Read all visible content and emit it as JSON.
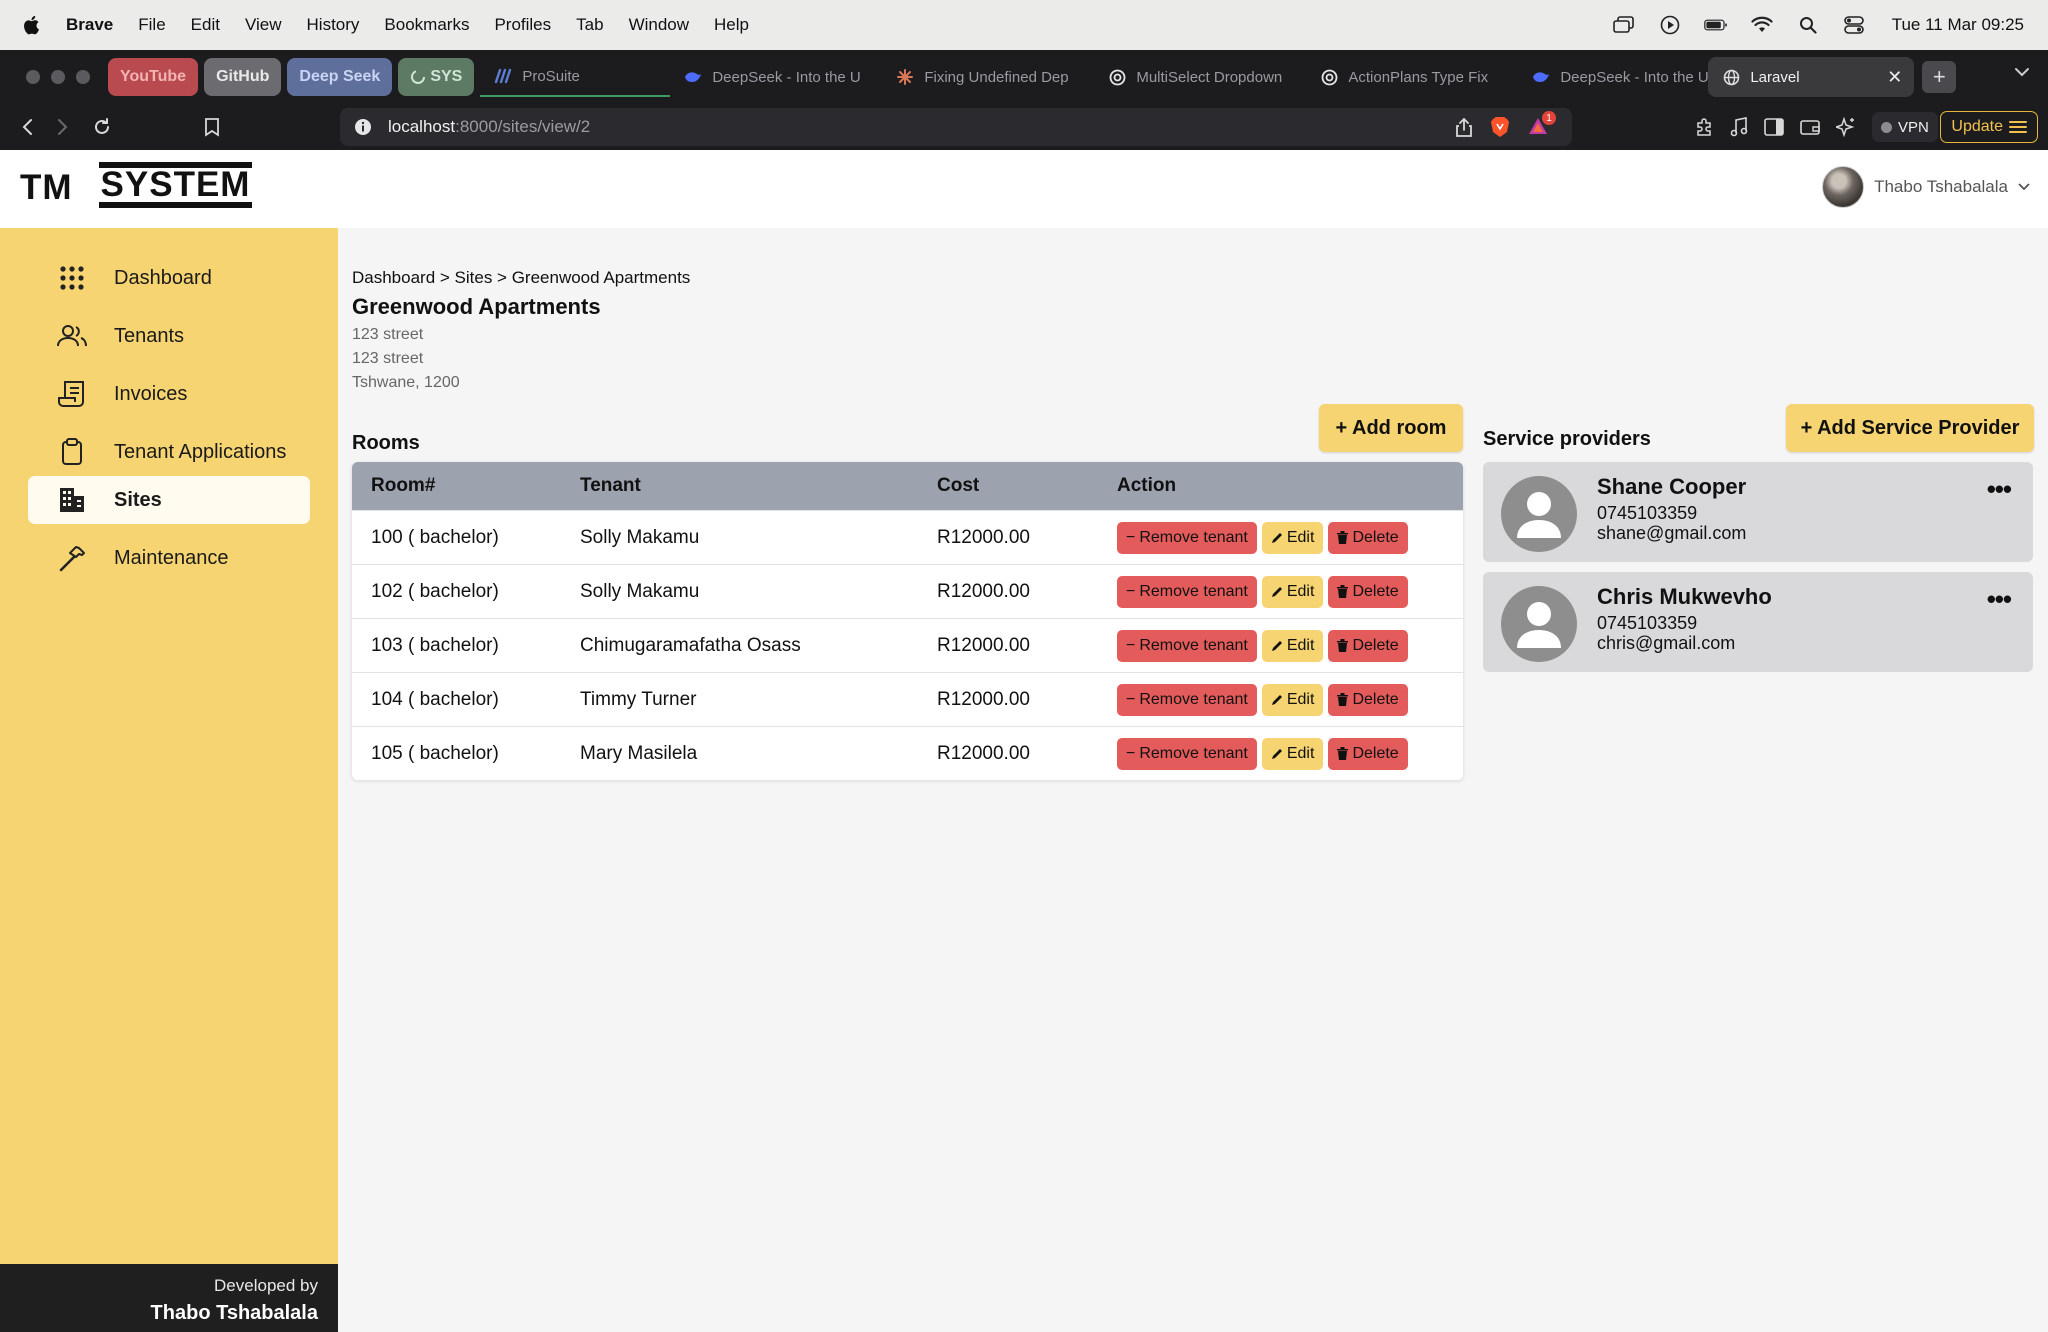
{
  "menubar": {
    "app_name": "Brave",
    "items": [
      "File",
      "Edit",
      "View",
      "History",
      "Bookmarks",
      "Profiles",
      "Tab",
      "Window",
      "Help"
    ],
    "clock": "Tue 11 Mar  09:25"
  },
  "browser": {
    "pinned_tabs": [
      {
        "label": "YouTube",
        "bg": "#b94a4f",
        "fg": "#f2b3b3"
      },
      {
        "label": "GitHub",
        "bg": "#6b6b70",
        "fg": "#e9e9ea"
      },
      {
        "label": "Deep Seek",
        "bg": "#5e6f9c",
        "fg": "#c9d4f4"
      },
      {
        "label": "SYS",
        "bg": "#5d7a65",
        "fg": "#cfe5d5"
      }
    ],
    "tabs": [
      {
        "label": "ProSuite",
        "icon": "prosuite-icon"
      },
      {
        "label": "DeepSeek - Into the U",
        "icon": "deepseek-icon"
      },
      {
        "label": "Fixing Undefined Dep",
        "icon": "claude-icon"
      },
      {
        "label": "MultiSelect Dropdown",
        "icon": "openai-icon"
      },
      {
        "label": "ActionPlans Type Fix",
        "icon": "openai-icon"
      },
      {
        "label": "DeepSeek - Into the U",
        "icon": "deepseek-icon"
      }
    ],
    "active_tab": {
      "label": "Laravel",
      "icon": "globe-icon"
    },
    "url_host": "localhost",
    "url_path": ":8000/sites/view/2",
    "vpn_label": "VPN",
    "update_label": "Update",
    "notification_count": "1"
  },
  "header": {
    "logo_left": "TM",
    "logo_right": "SYSTEM",
    "user_name": "Thabo Tshabalala"
  },
  "sidebar": {
    "items": [
      {
        "label": "Dashboard",
        "icon": "grid-icon"
      },
      {
        "label": "Tenants",
        "icon": "users-icon"
      },
      {
        "label": "Invoices",
        "icon": "invoice-icon"
      },
      {
        "label": "Tenant Applications",
        "icon": "clipboard-icon"
      },
      {
        "label": "Sites",
        "icon": "building-icon",
        "active": true
      },
      {
        "label": "Maintenance",
        "icon": "hammer-icon"
      }
    ],
    "footer_line1": "Developed by",
    "footer_line2": "Thabo Tshabalala"
  },
  "page": {
    "breadcrumb": "Dashboard > Sites > Greenwood Apartments",
    "title": "Greenwood Apartments",
    "address": [
      "123 street",
      "123 street",
      "Tshwane, 1200"
    ]
  },
  "rooms": {
    "heading": "Rooms",
    "add_label": "+ Add room",
    "columns": [
      "Room#",
      "Tenant",
      "Cost",
      "Action"
    ],
    "rows": [
      {
        "room": "100 ( bachelor)",
        "tenant": "Solly Makamu",
        "cost": "R12000.00"
      },
      {
        "room": "102 ( bachelor)",
        "tenant": "Solly Makamu",
        "cost": "R12000.00"
      },
      {
        "room": "103 ( bachelor)",
        "tenant": "Chimugaramafatha Osass",
        "cost": "R12000.00"
      },
      {
        "room": "104 ( bachelor)",
        "tenant": "Timmy Turner",
        "cost": "R12000.00"
      },
      {
        "room": "105 ( bachelor)",
        "tenant": "Mary Masilela",
        "cost": "R12000.00"
      }
    ],
    "actions": {
      "remove": "Remove tenant",
      "edit": "Edit",
      "delete": "Delete"
    }
  },
  "service_providers": {
    "heading": "Service providers",
    "add_label": "+ Add Service Provider",
    "items": [
      {
        "name": "Shane Cooper",
        "phone": "0745103359",
        "email": "shane@gmail.com"
      },
      {
        "name": "Chris Mukwevho",
        "phone": "0745103359",
        "email": "chris@gmail.com"
      }
    ]
  },
  "colors": {
    "accent_yellow": "#f7d472",
    "danger_red": "#e45b5b",
    "table_header": "#9ca3af"
  }
}
